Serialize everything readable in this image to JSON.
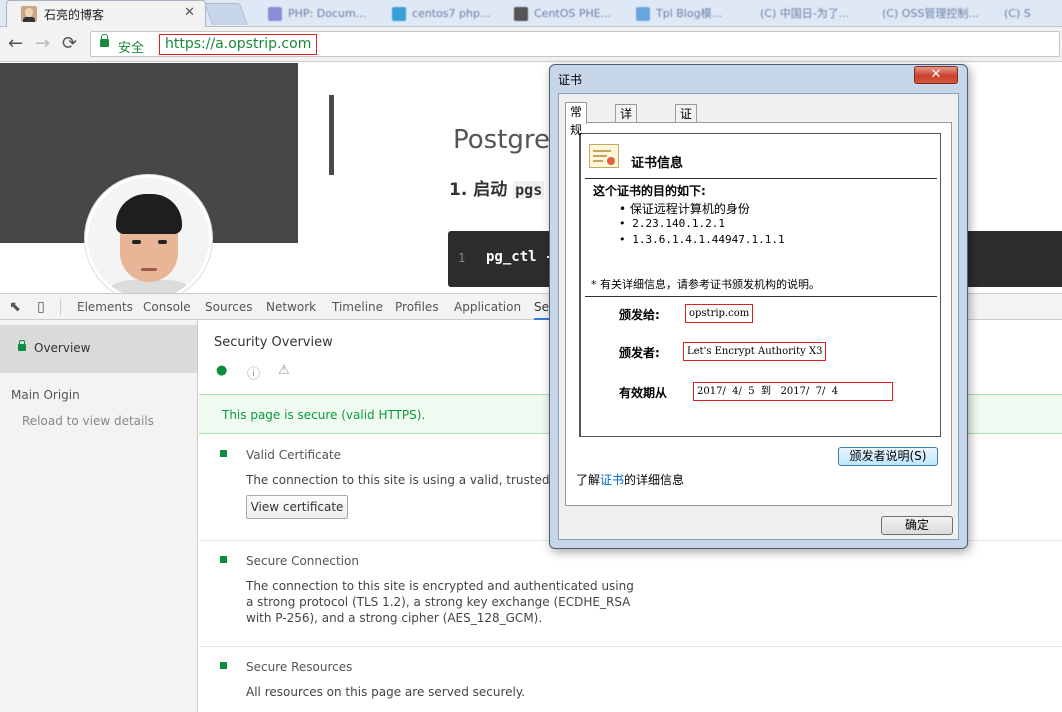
{
  "browser": {
    "active_tab": {
      "title": "石亮的博客",
      "close": "✕"
    },
    "background_tabs": [
      "PHP: Docum...",
      "centos7 php...",
      "CentOS PHE...",
      "Tpl Blog模...",
      "(C) 中国日-为了...",
      "(C) OSS管理控制...",
      "(C) S"
    ],
    "nav": {
      "back": "←",
      "forward": "→",
      "reload": "⟳"
    },
    "omnibox": {
      "secure_label": "安全",
      "url": "https://a.opstrip.com"
    }
  },
  "page": {
    "heading": "Postgre",
    "subheading_prefix": "1. 启动",
    "subheading_code": "pgs",
    "code": {
      "line_number": "1",
      "text": "pg_ctl -"
    }
  },
  "devtools": {
    "tabs": [
      "Elements",
      "Console",
      "Sources",
      "Network",
      "Timeline",
      "Profiles",
      "Application",
      "Se"
    ],
    "active_tab": "Se",
    "sidebar": {
      "overview": "Overview",
      "main_origin": "Main Origin",
      "reload_hint": "Reload to view details"
    },
    "main": {
      "title": "Security Overview",
      "banner": "This page is secure (valid HTTPS).",
      "sections": [
        {
          "title": "Valid Certificate",
          "desc": "The connection to this site is using a valid, trusted server c",
          "button": "View certificate"
        },
        {
          "title": "Secure Connection",
          "desc": "The connection to this site is encrypted and authenticated using a strong protocol (TLS 1.2), a strong key exchange (ECDHE_RSA with P-256), and a strong cipher (AES_128_GCM)."
        },
        {
          "title": "Secure Resources",
          "desc": "All resources on this page are served securely."
        }
      ]
    },
    "colors": {
      "secure_green": "#0a8d3e",
      "active_tab_underline": "#3879d9"
    }
  },
  "certificate_dialog": {
    "title": "证书",
    "close": "✕",
    "tabs": [
      "常规",
      "详细信息",
      "证书路径"
    ],
    "info_title": "证书信息",
    "purpose_heading": "这个证书的目的如下:",
    "purposes": [
      "• 保证远程计算机的身份",
      "• 2.23.140.1.2.1",
      "• 1.3.6.1.4.1.44947.1.1.1"
    ],
    "note": "* 有关详细信息，请参考证书颁发机构的说明。",
    "issued_to_label": "颁发给:",
    "issued_to": "opstrip.com",
    "issued_by_label": "颁发者:",
    "issued_by": "Let's Encrypt Authority X3",
    "valid_label": "有效期从",
    "valid_range": "2017/  4/  5  到   2017/  7/  4",
    "issuer_statement_button": "颁发者说明(S)",
    "learn_prefix": "了解",
    "learn_link": "证书",
    "learn_suffix": "的详细信息",
    "ok_button": "确定"
  }
}
